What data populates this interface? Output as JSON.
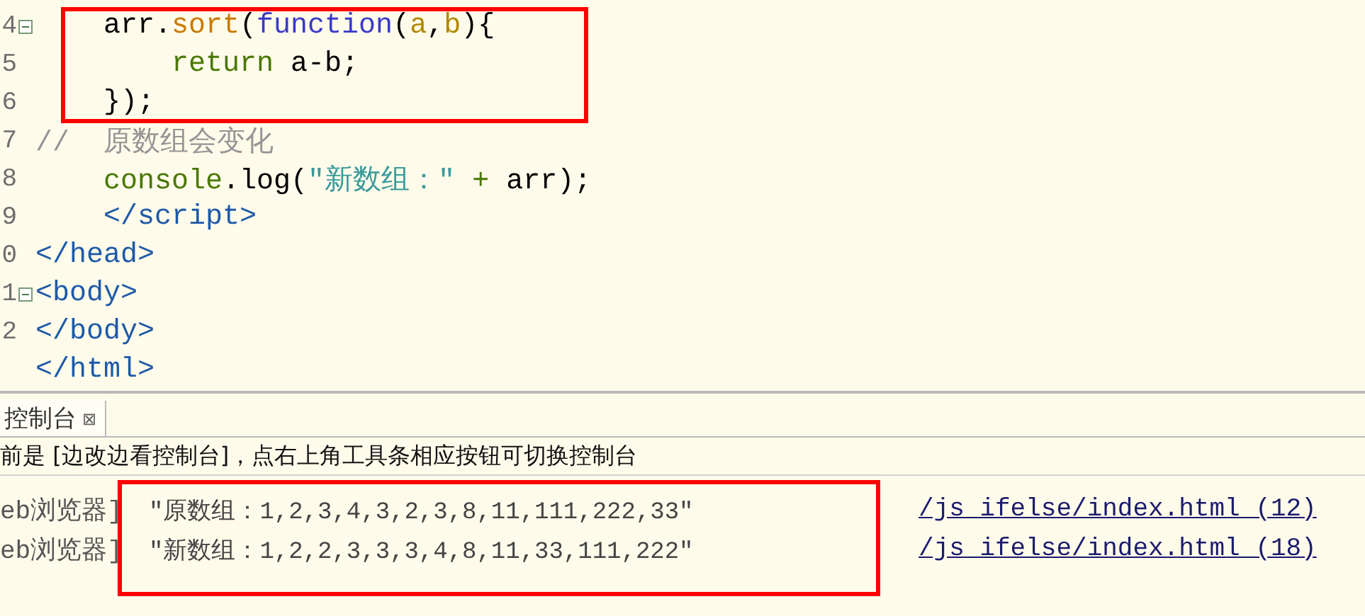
{
  "editor": {
    "framed": true,
    "lines": [
      {
        "number": "4",
        "fold": true,
        "framed": true,
        "tokens": [
          {
            "kind": "plain",
            "text": "    arr."
          },
          {
            "kind": "method",
            "text": "sort"
          },
          {
            "kind": "plain",
            "text": "("
          },
          {
            "kind": "keyword",
            "text": "function"
          },
          {
            "kind": "plain",
            "text": "("
          },
          {
            "kind": "param",
            "text": "a"
          },
          {
            "kind": "plain",
            "text": ","
          },
          {
            "kind": "param",
            "text": "b"
          },
          {
            "kind": "plain",
            "text": "){"
          }
        ]
      },
      {
        "number": "5",
        "fold": false,
        "framed": true,
        "tokens": [
          {
            "kind": "control",
            "text": "        return"
          },
          {
            "kind": "plain",
            "text": " a-b;"
          }
        ]
      },
      {
        "number": "6",
        "fold": false,
        "framed": true,
        "tokens": [
          {
            "kind": "plain",
            "text": "    });"
          }
        ]
      },
      {
        "number": "7",
        "fold": false,
        "framed": false,
        "tokens": [
          {
            "kind": "comment",
            "text": "//  原数组会变化"
          }
        ]
      },
      {
        "number": "8",
        "fold": false,
        "framed": false,
        "tokens": [
          {
            "kind": "control",
            "text": "    console"
          },
          {
            "kind": "plain",
            "text": ".log("
          },
          {
            "kind": "string",
            "text": "\"新数组：\""
          },
          {
            "kind": "control",
            "text": " +"
          },
          {
            "kind": "plain",
            "text": " arr);"
          }
        ]
      },
      {
        "number": "9",
        "fold": false,
        "framed": false,
        "tokens": [
          {
            "kind": "tag",
            "text": "    </script>"
          }
        ]
      },
      {
        "number": "0",
        "fold": false,
        "framed": false,
        "tokens": [
          {
            "kind": "tag",
            "text": "</head>"
          }
        ]
      },
      {
        "number": "1",
        "fold": true,
        "framed": false,
        "tokens": [
          {
            "kind": "tag",
            "text": "<body>"
          }
        ]
      },
      {
        "number": "2",
        "fold": false,
        "framed": false,
        "tokens": [
          {
            "kind": "tag",
            "text": "</body>"
          }
        ]
      },
      {
        "fold": false,
        "framed": false,
        "tokens": [
          {
            "kind": "tag",
            "text": "</html>"
          }
        ]
      }
    ]
  },
  "console": {
    "framed": true,
    "tab": {
      "label": "控制台",
      "close": "⊠",
      "selected": true
    },
    "info": "前是 [边改边看控制台]，点右上角工具条相应按钮可切换控制台",
    "rows": [
      {
        "source": "eb浏览器]",
        "message": "\"原数组：1,2,3,4,3,2,3,8,11,111,222,33\"",
        "link": "/js_ifelse/index.html (12)"
      },
      {
        "source": "eb浏览器]",
        "message": "\"新数组：1,2,2,3,3,3,4,8,11,33,111,222\"",
        "link": "/js_ifelse/index.html (18)"
      }
    ]
  }
}
